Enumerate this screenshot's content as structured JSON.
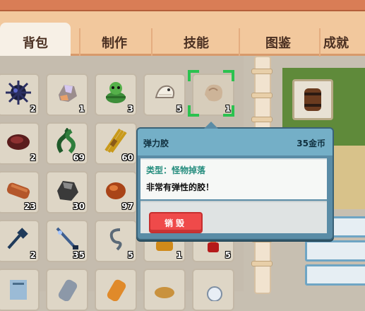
{
  "tabs": [
    {
      "label": "背包",
      "active": true
    },
    {
      "label": "制作",
      "active": false
    },
    {
      "label": "技能",
      "active": false
    },
    {
      "label": "图鉴",
      "active": false
    },
    {
      "label": "成就",
      "active": false
    }
  ],
  "inventory": [
    {
      "icon": "black-urchin-icon",
      "count": "2"
    },
    {
      "icon": "crystal-ore-icon",
      "count": "1"
    },
    {
      "icon": "green-caterpillar-icon",
      "count": "3"
    },
    {
      "icon": "white-larva-icon",
      "count": "5"
    },
    {
      "icon": "slime-gel-icon",
      "count": "1"
    },
    {
      "icon": "red-stone-icon",
      "count": "2"
    },
    {
      "icon": "green-vine-icon",
      "count": "69"
    },
    {
      "icon": "wheat-bundle-icon",
      "count": "60"
    },
    {
      "icon": "wood-log-icon",
      "count": "23"
    },
    {
      "icon": "coal-ore-icon",
      "count": "30"
    },
    {
      "icon": "copper-ore-icon",
      "count": "97"
    },
    {
      "icon": "hammer-icon",
      "count": "2"
    },
    {
      "icon": "sword-icon",
      "count": "35"
    },
    {
      "icon": "rope-icon",
      "count": "5"
    },
    {
      "icon": "honey-jar-icon",
      "count": "1"
    },
    {
      "icon": "red-potion-icon",
      "count": "5"
    },
    {
      "icon": "book-icon",
      "count": ""
    },
    {
      "icon": "stone-icon",
      "count": ""
    },
    {
      "icon": "orange-gem-icon",
      "count": ""
    },
    {
      "icon": "bread-icon",
      "count": ""
    },
    {
      "icon": "pearl-icon",
      "count": ""
    }
  ],
  "tooltip": {
    "name": "弹力胶",
    "price": "35金币",
    "type": "类型：怪物掉落",
    "description": "非常有弹性的胶！",
    "destroy_label": "销毁"
  },
  "right_panel": {
    "icon": "wooden-barrel-icon"
  },
  "colors": {
    "accent_tab": "#f2c89d",
    "tooltip_header": "#74afc7",
    "destroy_button": "#ef4a4a",
    "selection": "#2bc24f"
  }
}
